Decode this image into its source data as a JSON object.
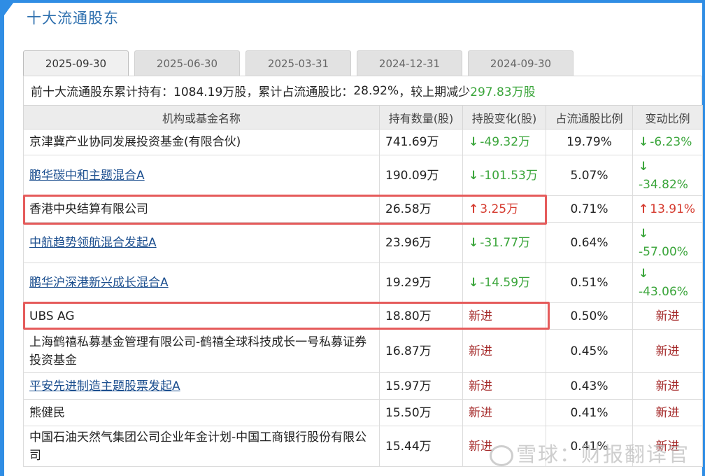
{
  "section_title": "十大流通股东",
  "tabs": [
    {
      "label": "2025-09-30",
      "active": true
    },
    {
      "label": "2025-06-30",
      "active": false
    },
    {
      "label": "2025-03-31",
      "active": false
    },
    {
      "label": "2024-12-31",
      "active": false
    },
    {
      "label": "2024-09-30",
      "active": false
    }
  ],
  "summary": {
    "prefix": "前十大流通股东累计持有：",
    "total_shares": "1084.19万股",
    "middle": "，累计占流通股比：",
    "ratio": "28.92%",
    "suffix": "，较上期减少",
    "decrease": "297.83万股"
  },
  "table": {
    "headers": [
      "机构或基金名称",
      "持有数量(股)",
      "持股变化(股)",
      "占流通股比例",
      "变动比例"
    ],
    "rows": [
      {
        "name": "京津冀产业协同发展投资基金(有限合伙)",
        "link": false,
        "shares": "741.69万",
        "change": "-49.32万",
        "change_dir": "down",
        "ratio": "19.79%",
        "pct": "-6.23%",
        "pct_dir": "down"
      },
      {
        "name": "鹏华碳中和主题混合A",
        "link": true,
        "shares": "190.09万",
        "change": "-101.53万",
        "change_dir": "down",
        "ratio": "5.07%",
        "pct": "-34.82%",
        "pct_dir": "down"
      },
      {
        "name": "香港中央结算有限公司",
        "link": false,
        "shares": "26.58万",
        "change": "3.25万",
        "change_dir": "up",
        "ratio": "0.71%",
        "pct": "13.91%",
        "pct_dir": "up"
      },
      {
        "name": "中航趋势领航混合发起A",
        "link": true,
        "shares": "23.96万",
        "change": "-31.77万",
        "change_dir": "down",
        "ratio": "0.64%",
        "pct": "-57.00%",
        "pct_dir": "down"
      },
      {
        "name": "鹏华沪深港新兴成长混合A",
        "link": true,
        "shares": "19.29万",
        "change": "-14.59万",
        "change_dir": "down",
        "ratio": "0.51%",
        "pct": "-43.06%",
        "pct_dir": "down"
      },
      {
        "name": "UBS AG",
        "link": false,
        "shares": "18.80万",
        "change": "新进",
        "change_dir": "new",
        "ratio": "0.50%",
        "pct": "新进",
        "pct_dir": "new"
      },
      {
        "name": "上海鹤禧私募基金管理有限公司-鹤禧全球科技成长一号私募证券投资基金",
        "link": false,
        "shares": "16.87万",
        "change": "新进",
        "change_dir": "new",
        "ratio": "0.45%",
        "pct": "新进",
        "pct_dir": "new"
      },
      {
        "name": "平安先进制造主题股票发起A",
        "link": true,
        "shares": "15.97万",
        "change": "新进",
        "change_dir": "new",
        "ratio": "0.43%",
        "pct": "新进",
        "pct_dir": "new"
      },
      {
        "name": "熊健民",
        "link": false,
        "shares": "15.50万",
        "change": "新进",
        "change_dir": "new",
        "ratio": "0.41%",
        "pct": "新进",
        "pct_dir": "new"
      },
      {
        "name": "中国石油天然气集团公司企业年金计划-中国工商银行股份有限公司",
        "link": false,
        "shares": "15.44万",
        "change": "新进",
        "change_dir": "new",
        "ratio": "0.41%",
        "pct": "新进",
        "pct_dir": "new"
      }
    ]
  },
  "watermark": "雪球：财报翻译官",
  "colors": {
    "accent": "#2f8de4",
    "down": "#3aa53a",
    "up": "#d53b2f",
    "new": "#a52a2a",
    "highlight": "#e55b5b"
  }
}
